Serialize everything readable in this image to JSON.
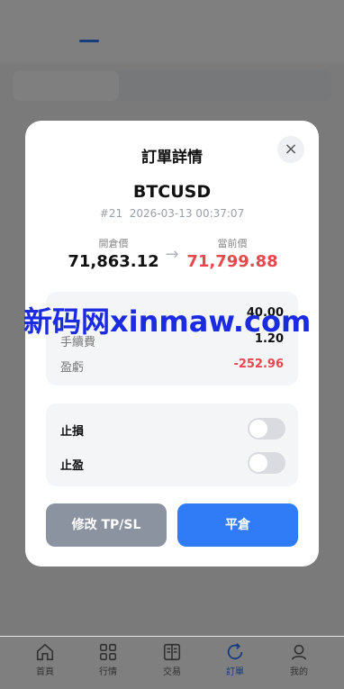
{
  "background": {
    "tabs": [
      "",
      ""
    ],
    "segments": [
      "",
      "",
      ""
    ]
  },
  "modal": {
    "title": "訂單詳情",
    "symbol": "BTCUSD",
    "order_id": "#21",
    "timestamp": "2026-03-13 00:37:07",
    "open_price_label": "開倉價",
    "open_price": "71,863.12",
    "current_price_label": "當前價",
    "current_price": "71,799.88",
    "info": [
      {
        "label": "",
        "value": "40.00"
      },
      {
        "label": "手續費",
        "value": "1.20"
      },
      {
        "label": "盈虧",
        "value": "-252.96"
      }
    ],
    "stop_loss_label": "止損",
    "take_profit_label": "止盈",
    "stop_loss_on": false,
    "take_profit_on": false,
    "modify_button": "修改 TP/SL",
    "close_button": "平倉"
  },
  "watermark": "新码网xinmaw.com",
  "nav": {
    "items": [
      {
        "label": "首頁",
        "icon": "home-icon"
      },
      {
        "label": "行情",
        "icon": "market-icon"
      },
      {
        "label": "交易",
        "icon": "trade-icon"
      },
      {
        "label": "訂單",
        "icon": "orders-icon"
      },
      {
        "label": "我的",
        "icon": "profile-icon"
      }
    ],
    "active": "訂單"
  },
  "colors": {
    "accent": "#2f7cf6",
    "negative": "#e5484d",
    "modify_button": "#8b93a0"
  }
}
